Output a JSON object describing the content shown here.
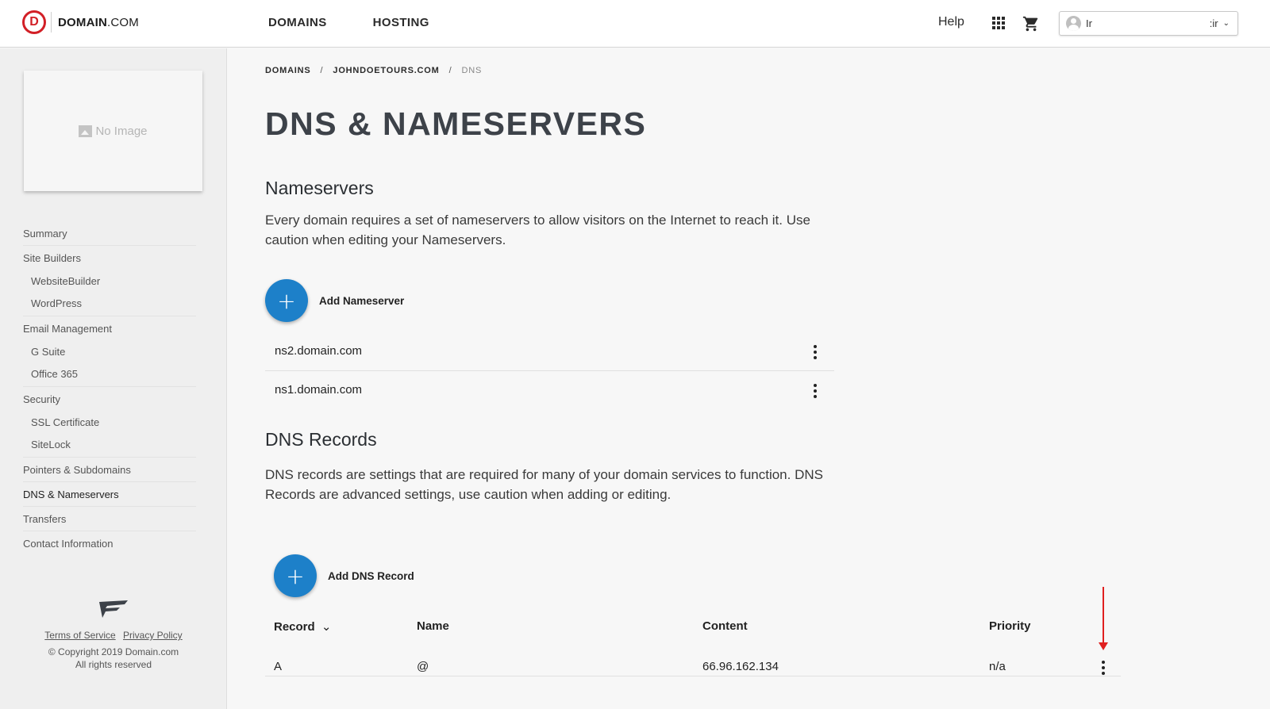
{
  "header": {
    "logo_letter": "D",
    "logo_brand": "DOMAIN",
    "logo_tld": ".COM",
    "nav": [
      "DOMAINS",
      "HOSTING"
    ],
    "help_label": "Help",
    "account_name": "Ir",
    "account_suffix": ":ir"
  },
  "sidebar": {
    "no_image_label": "No Image",
    "items": [
      {
        "label": "Summary"
      },
      {
        "label": "Site Builders"
      },
      {
        "label": "WebsiteBuilder"
      },
      {
        "label": "WordPress"
      },
      {
        "label": "Email Management"
      },
      {
        "label": "G Suite"
      },
      {
        "label": "Office 365"
      },
      {
        "label": "Security"
      },
      {
        "label": "SSL Certificate"
      },
      {
        "label": "SiteLock"
      },
      {
        "label": "Pointers & Subdomains"
      },
      {
        "label": "DNS & Nameservers"
      },
      {
        "label": "Transfers"
      },
      {
        "label": "Contact Information"
      }
    ],
    "footer": {
      "terms": "Terms of Service",
      "privacy": "Privacy Policy",
      "copyright": "© Copyright 2019 Domain.com",
      "rights": "All rights reserved"
    }
  },
  "breadcrumb": {
    "items": [
      "DOMAINS",
      "JOHNDOETOURS.COM",
      "DNS"
    ],
    "separator": "/"
  },
  "page_title": "DNS & NAMESERVERS",
  "nameservers": {
    "heading": "Nameservers",
    "description": "Every domain requires a set of nameservers to allow visitors on the Internet to reach it. Use caution when editing your Nameservers.",
    "add_label": "Add Nameserver",
    "add_symbol": "+",
    "entries": [
      "ns2.domain.com",
      "ns1.domain.com"
    ]
  },
  "dns_records": {
    "heading": "DNS Records",
    "description": "DNS records are settings that are required for many of your domain services to function. DNS Records are advanced settings, use caution when adding or editing.",
    "add_label": "Add DNS Record",
    "add_symbol": "+",
    "columns": {
      "record": "Record",
      "record_sort_icon": "⌄",
      "name": "Name",
      "content": "Content",
      "priority": "Priority"
    },
    "rows": [
      {
        "record": "A",
        "name": "@",
        "content": "66.96.162.134",
        "priority": "n/a"
      }
    ]
  },
  "colors": {
    "brand_red": "#d21f26",
    "action_blue": "#1d80c9",
    "annotation_red": "#e02020"
  }
}
